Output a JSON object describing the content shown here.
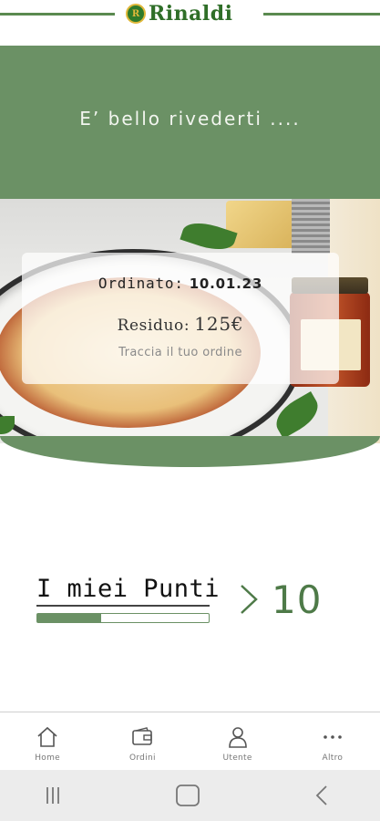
{
  "header": {
    "brand_name": "Rinaldi",
    "brand_initial": "R"
  },
  "welcome": {
    "text": "E’ bello rivederti ...."
  },
  "order_card": {
    "ordered_label": "Ordinato:",
    "ordered_date": "10.01.23",
    "residue_label": "Residuo:",
    "residue_value": "125€",
    "track_link": "Traccia il tuo ordine"
  },
  "points": {
    "title": "I miei Punti",
    "value": "10",
    "progress_fraction": 0.37
  },
  "bottom_nav": {
    "items": [
      {
        "label": "Home",
        "icon": "home-icon"
      },
      {
        "label": "Ordini",
        "icon": "wallet-icon"
      },
      {
        "label": "Utente",
        "icon": "user-icon"
      },
      {
        "label": "Altro",
        "icon": "more-dots-icon"
      }
    ]
  },
  "system_nav": {
    "icons": [
      "recent-apps-icon",
      "home-square-icon",
      "back-chevron-icon"
    ]
  },
  "colors": {
    "primary_green": "#6b9165",
    "brand_green": "#2f6e28",
    "points_green": "#4e7a48"
  }
}
